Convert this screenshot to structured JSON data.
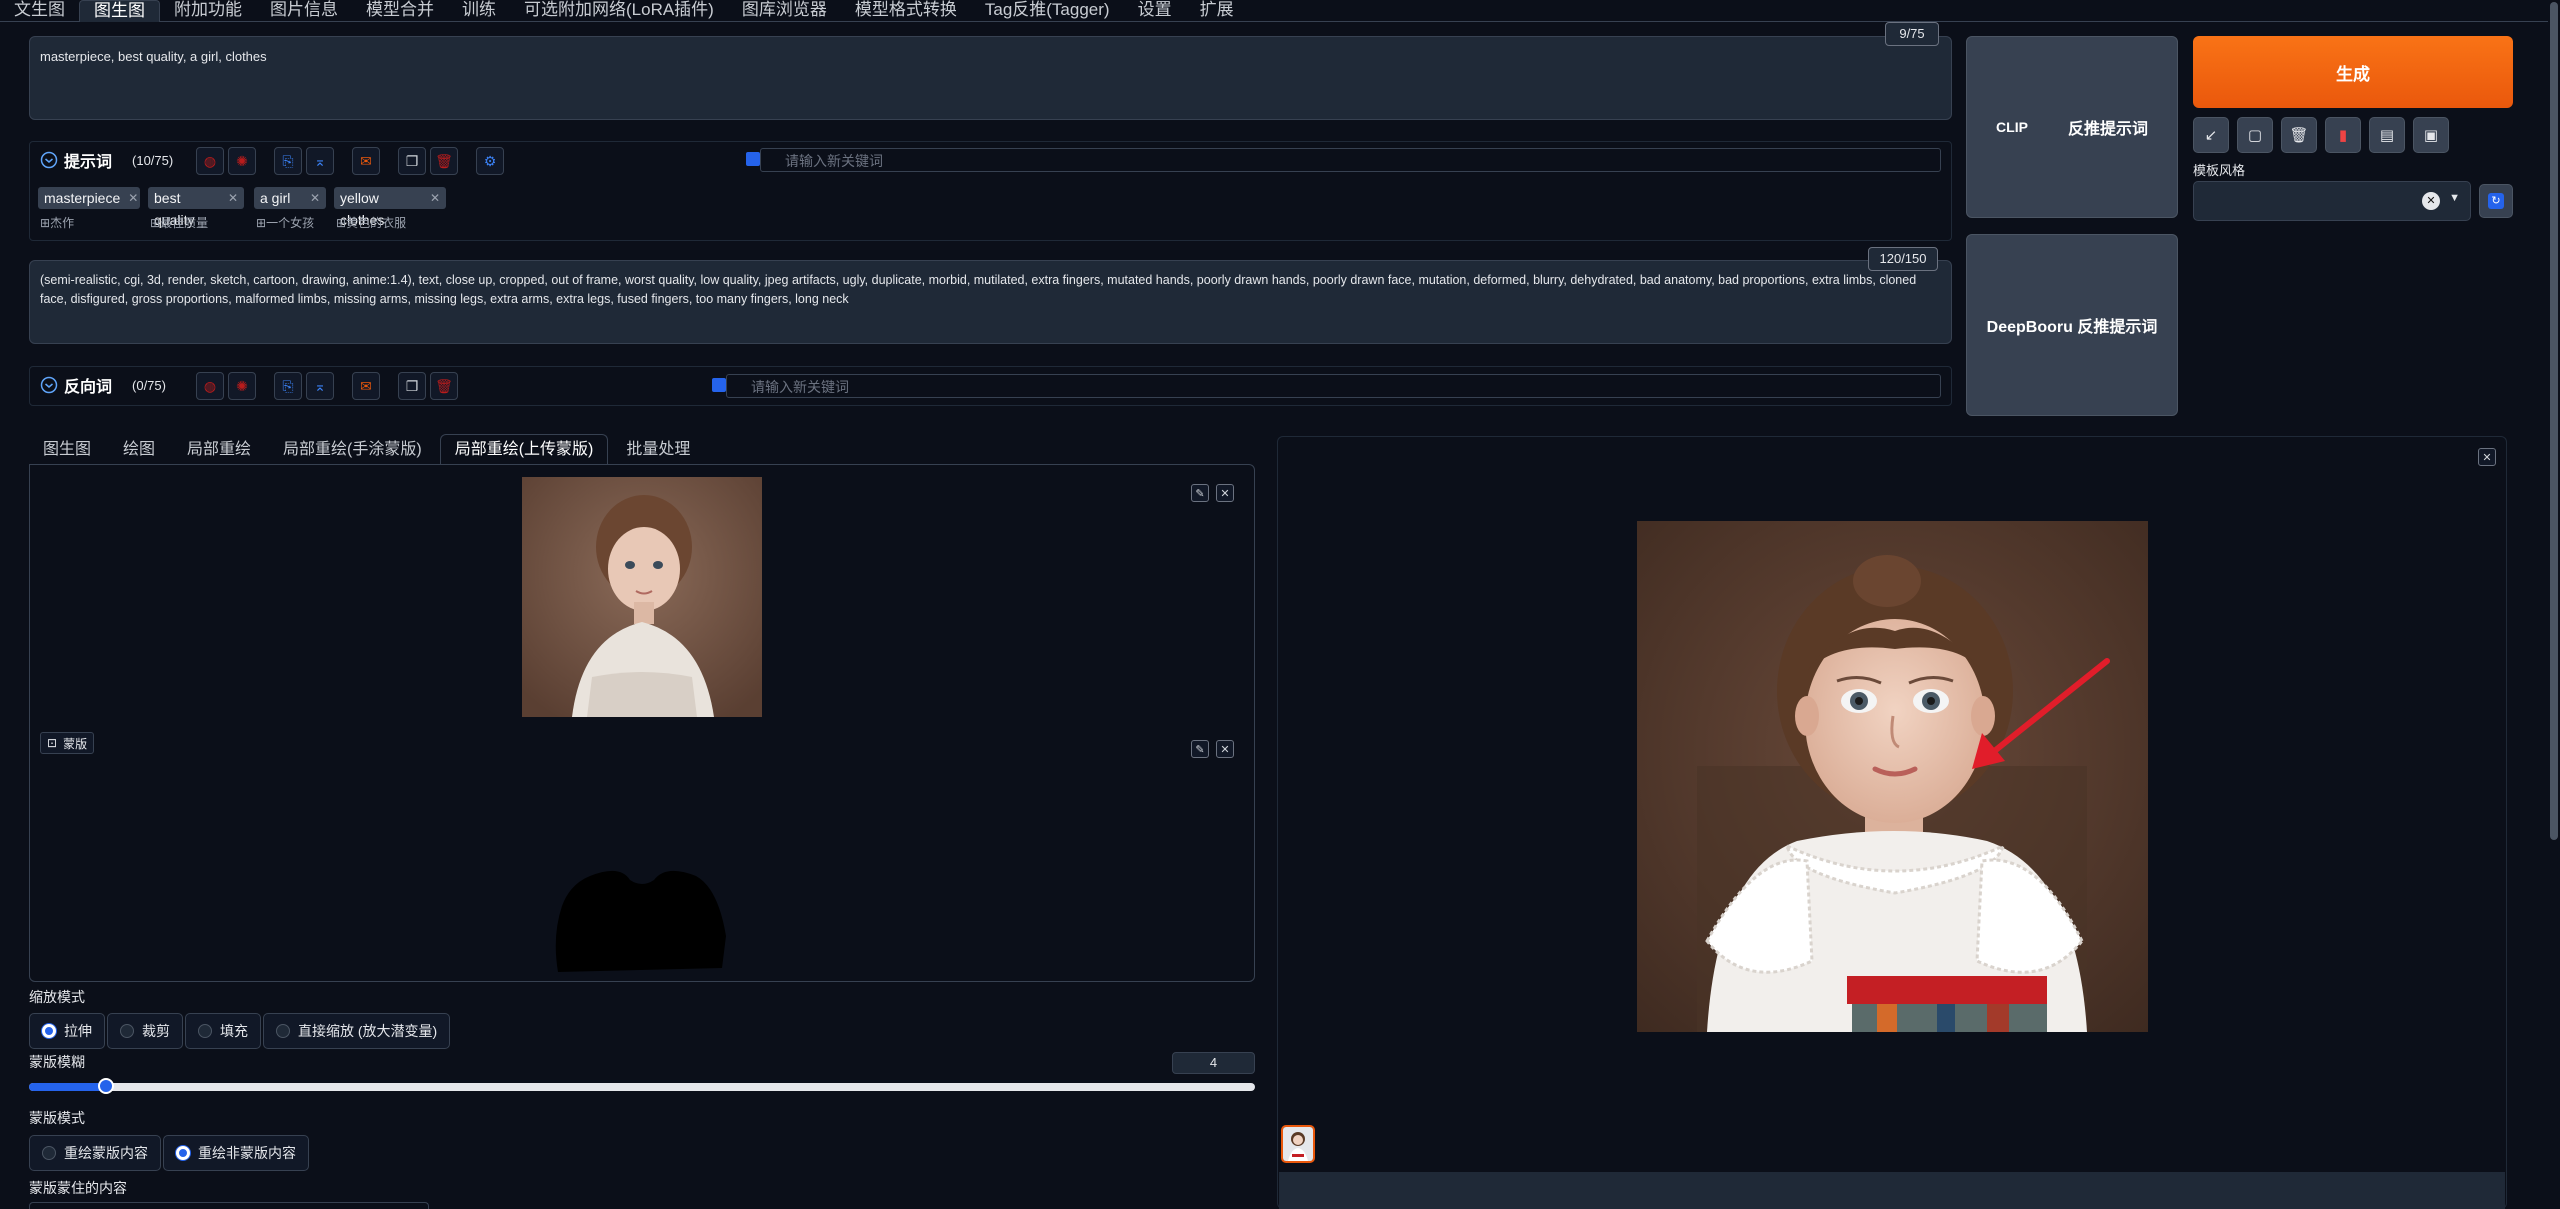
{
  "topnav": {
    "tabs": [
      {
        "label": "文生图"
      },
      {
        "label": "图生图"
      },
      {
        "label": "附加功能"
      },
      {
        "label": "图片信息"
      },
      {
        "label": "模型合并"
      },
      {
        "label": "训练"
      },
      {
        "label": "可选附加网络(LoRA插件)"
      },
      {
        "label": "图库浏览器"
      },
      {
        "label": "模型格式转换"
      },
      {
        "label": "Tag反推(Tagger)"
      },
      {
        "label": "设置"
      },
      {
        "label": "扩展"
      }
    ],
    "active": "图生图"
  },
  "prompt": {
    "text": "masterpiece, best quality, a girl,  clothes",
    "counter": "9/75",
    "label": "提示词",
    "count": "(10/75)",
    "keyword_placeholder": "请输入新关键词",
    "tags": [
      {
        "en": "masterpiece",
        "zh": "杰作"
      },
      {
        "en": "best quality",
        "zh": "最佳质量"
      },
      {
        "en": "a girl",
        "zh": "一个女孩"
      },
      {
        "en": "yellow clothes",
        "zh": "黄色的衣服"
      }
    ]
  },
  "negative": {
    "text": "(semi-realistic, cgi, 3d, render, sketch, cartoon, drawing, anime:1.4), text, close up, cropped, out of frame, worst quality, low quality, jpeg artifacts, ugly, duplicate, morbid, mutilated, extra fingers, mutated hands, poorly drawn hands, poorly drawn face, mutation, deformed, blurry, dehydrated, bad anatomy, bad proportions, extra limbs, cloned face, disfigured, gross proportions, malformed limbs, missing arms, missing legs, extra arms, extra legs, fused fingers, too many fingers, long neck",
    "counter": "120/150",
    "label": "反向词",
    "count": "(0/75)",
    "keyword_placeholder": "请输入新关键词"
  },
  "side": {
    "clip_label": "CLIP",
    "clip_action": "反推提示词",
    "deepbooru_label": "DeepBooru 反推提示词",
    "generate_label": "生成",
    "style_label": "模板风格",
    "small_buttons": [
      "pencil-icon",
      "square-icon",
      "trash-icon",
      "bookmark-icon",
      "clipboard-icon",
      "save-icon"
    ]
  },
  "subtabs": {
    "items": [
      {
        "label": "图生图"
      },
      {
        "label": "绘图"
      },
      {
        "label": "局部重绘"
      },
      {
        "label": "局部重绘(手涂蒙版)"
      },
      {
        "label": "局部重绘(上传蒙版)"
      },
      {
        "label": "批量处理"
      }
    ],
    "active": "局部重绘(上传蒙版)"
  },
  "mask": {
    "label": "蒙版"
  },
  "resize": {
    "label": "缩放模式",
    "options": [
      {
        "label": "拉伸",
        "selected": true
      },
      {
        "label": "裁剪",
        "selected": false
      },
      {
        "label": "填充",
        "selected": false
      },
      {
        "label": "直接缩放 (放大潜变量)",
        "selected": false
      }
    ]
  },
  "mask_blur": {
    "label": "蒙版模糊",
    "value": "4",
    "fraction": 0.0625
  },
  "mask_mode": {
    "label": "蒙版模式",
    "options": [
      {
        "label": "重绘蒙版内容",
        "selected": false
      },
      {
        "label": "重绘非蒙版内容",
        "selected": true
      }
    ]
  },
  "masked_content": {
    "label": "蒙版蒙住的内容"
  },
  "colors": {
    "accent": "#ea580c",
    "primary": "#2563eb",
    "arrow": "#e11d2a"
  }
}
